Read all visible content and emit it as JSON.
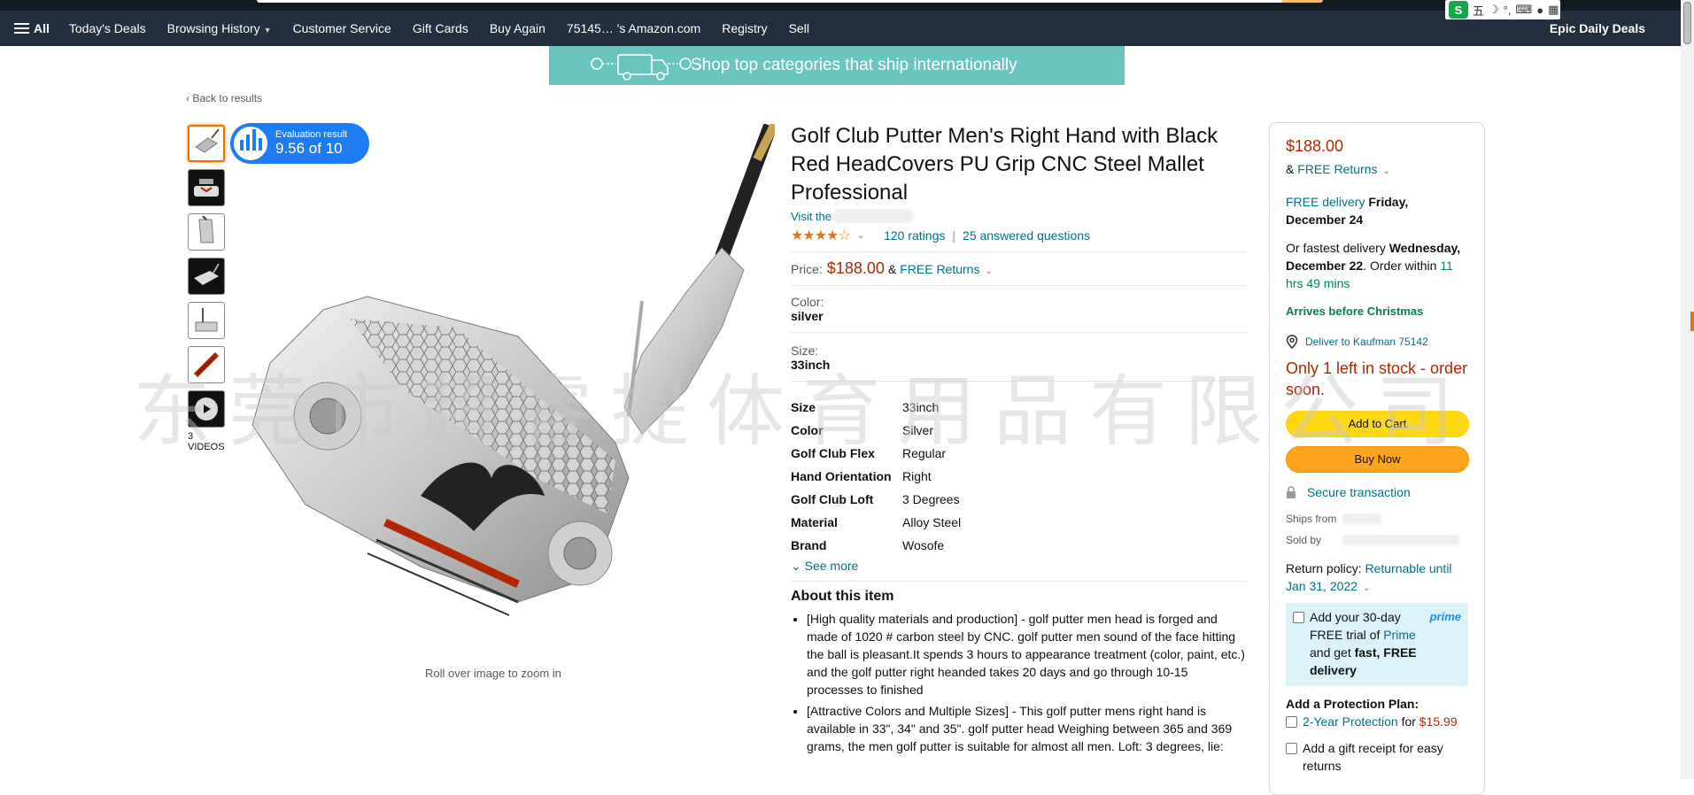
{
  "nav": {
    "all_label": "All",
    "items": [
      "Today's Deals",
      "Browsing History",
      "Customer Service",
      "Gift Cards",
      "Buy Again",
      "75145… 's Amazon.com",
      "Registry",
      "Sell"
    ],
    "promo": "Epic Daily Deals"
  },
  "ime": {
    "logo": "S",
    "mode": "五"
  },
  "banner": {
    "text": "Shop top categories that ship internationally"
  },
  "back_link": "Back to results",
  "gallery": {
    "videos_label": "3 VIDEOS",
    "zoom_hint": "Roll over image to zoom in"
  },
  "badge": {
    "line1": "Evaluation result",
    "line2": "9.56 of 10"
  },
  "product": {
    "title": "Golf Club Putter Men's Right Hand with Black Red HeadCovers PU Grip CNC Steel Mallet Professional",
    "visit_prefix": "Visit the",
    "stars": "★★★★☆",
    "ratings": "120 ratings",
    "answered": "25 answered questions",
    "price_label": "Price:",
    "price": "$188.00",
    "free_returns": "FREE Returns",
    "color_label": "Color:",
    "color_value": "silver",
    "size_label": "Size:",
    "size_value": "33inch",
    "specs": [
      {
        "k": "Size",
        "v": "33inch"
      },
      {
        "k": "Color",
        "v": "Silver"
      },
      {
        "k": "Golf Club Flex",
        "v": "Regular"
      },
      {
        "k": "Hand Orientation",
        "v": "Right"
      },
      {
        "k": "Golf Club Loft",
        "v": "3 Degrees"
      },
      {
        "k": "Material",
        "v": "Alloy Steel"
      },
      {
        "k": "Brand",
        "v": "Wosofe"
      }
    ],
    "see_more": "See more",
    "about_title": "About this item",
    "bullets": [
      "[High quality materials and production] - golf putter men head is forged and made of 1020 # carbon steel by CNC. golf putter men sound of the face hitting the ball is pleasant.It spends 3 hours to appearance treatment (color, paint, etc.) and the golf putter right heanded takes 20 days and go through 10-15 processes to finished",
      "[Attractive Colors and Multiple Sizes] - This golf putter mens right hand is available in 33\", 34\" and 35\". golf putter head Weighing between 365 and 369 grams, the men golf putter is suitable for almost all men. Loft: 3 degrees, lie:"
    ]
  },
  "buybox": {
    "price": "$188.00",
    "free_returns": "FREE Returns",
    "delivery_prefix": "FREE delivery",
    "delivery_date": "Friday, December 24",
    "fastest_prefix": "Or fastest delivery",
    "fastest_date": "Wednesday, December 22",
    "order_within": ". Order within",
    "countdown": "11 hrs 49 mins",
    "christmas": "Arrives before Christmas",
    "deliver_to": "Deliver to Kaufman 75142",
    "stock": "Only 1 left in stock - order soon.",
    "add_to_cart": "Add to Cart",
    "buy_now": "Buy Now",
    "secure": "Secure transaction",
    "ships_from": "Ships from",
    "sold_by": "Sold by",
    "return_policy_label": "Return policy:",
    "return_policy_link": "Returnable until Jan 31, 2022",
    "prime_text_1": "Add your 30-day FREE trial of",
    "prime_word": "Prime",
    "prime_text_2": "and get",
    "prime_text_3": "fast, FREE delivery",
    "prime_logo": "prime",
    "protection_title": "Add a Protection Plan:",
    "protection_item": "2-Year Protection",
    "protection_for": "for",
    "protection_price": "$15.99",
    "gift_receipt": "Add a gift receipt for easy returns"
  },
  "watermark": "东莞市超睿提体育用品有限公司",
  "colors": {
    "nav": "#232f3e",
    "navtop": "#131921",
    "price": "#b12704",
    "link": "#007185",
    "cart": "#ffd814",
    "buy": "#ffa41c",
    "banner": "#6bc4c0"
  }
}
